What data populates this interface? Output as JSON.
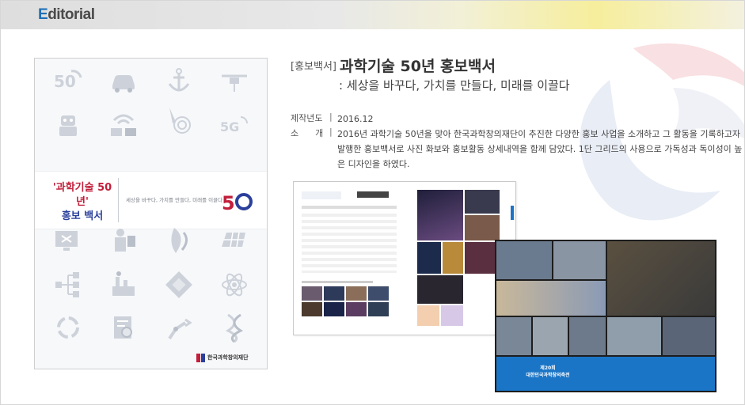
{
  "header": {
    "title_first": "E",
    "title_rest": "ditorial"
  },
  "book": {
    "category": "[홍보백서]",
    "title": "과학기술 50년 홍보백서",
    "subtitle": ": 세상을 바꾸다, 가치를 만들다, 미래를 이끌다",
    "meta": {
      "year_label": "제작년도",
      "year_value": "2016.12",
      "intro_label": "소      개",
      "intro_value": "2016년 과학기술 50년을 맞아 한국과학창의재단이 추진한 다양한 홍보 사업을 소개하고 그 활동을 기록하고자 발행한 홍보백서로 사진 화보와 홍보활동 상세내역을 함께 담았다. 1단 그리드의 사용으로 가독성과 독이성이 높은 디자인을 하였다."
    }
  },
  "cover": {
    "title_line1": "'과학기술 50년'",
    "title_line2": "홍보 백서",
    "sub": "세상을 바꾸다, 가치를 만들다, 미래를 이끌다",
    "logo_text": "한국과학창의재단",
    "icons": [
      "50-icon",
      "car-icon",
      "anchor-icon",
      "drone-icon",
      "robot-icon",
      "wifi-hands-icon",
      "touch-icon",
      "5g-icon",
      "monitor-icon",
      "person-icon",
      "dna-flame-icon",
      "solar-panel-icon",
      "network-icon",
      "factory-icon",
      "chip-icon",
      "atom-icon",
      "circle-arrows-icon",
      "report-icon",
      "robot-arm-icon",
      "dna-icon"
    ],
    "colors": {
      "title": "#c11f3b",
      "title2": "#2b3f9b",
      "icon": "#cdd2da"
    }
  },
  "photo_page": {
    "band_title_line1": "제20회",
    "band_title_line2": "대한민국과학창의축전",
    "band_color": "#1b75c6"
  }
}
